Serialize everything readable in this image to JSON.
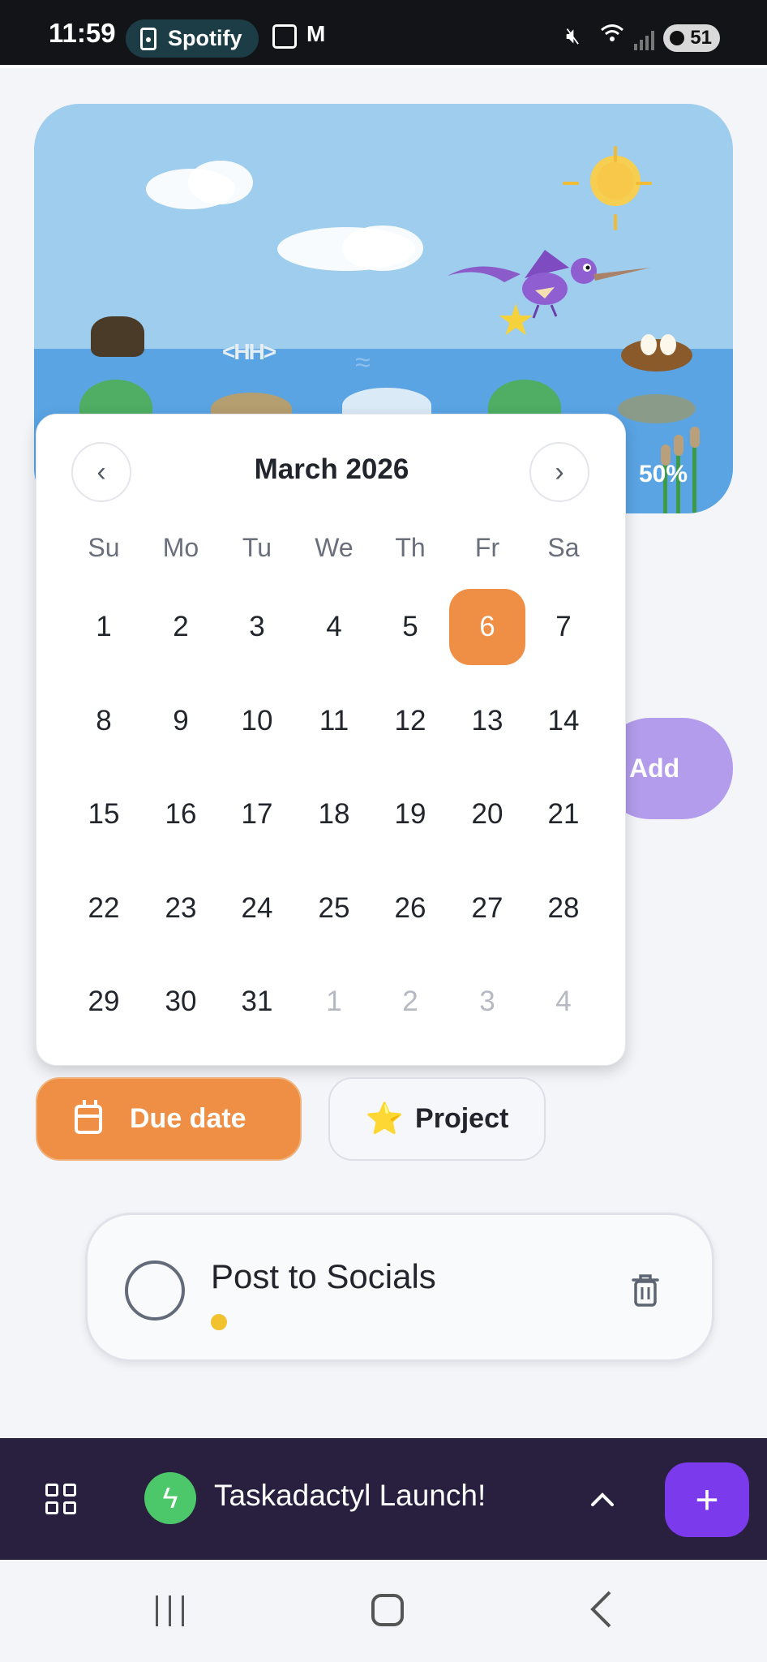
{
  "status_bar": {
    "time": "11:59",
    "media_app": "Spotify",
    "battery": "51",
    "icons": [
      "spotify-speaker-icon",
      "screenshot-icon",
      "gmail-icon",
      "mute-icon",
      "wifi-icon",
      "signal-icon",
      "battery-icon"
    ]
  },
  "scene": {
    "progress_label": "50%",
    "colors": {
      "sky": "#9ecdee",
      "water": "#5aa4e4"
    }
  },
  "add_button": {
    "label": "Add"
  },
  "calendar": {
    "month_title": "March 2026",
    "prev_icon": "chevron-left-icon",
    "next_icon": "chevron-right-icon",
    "weekdays": [
      "Su",
      "Mo",
      "Tu",
      "We",
      "Th",
      "Fr",
      "Sa"
    ],
    "days": [
      [
        "1",
        "2",
        "3",
        "4",
        "5",
        "6",
        "7"
      ],
      [
        "8",
        "9",
        "10",
        "11",
        "12",
        "13",
        "14"
      ],
      [
        "15",
        "16",
        "17",
        "18",
        "19",
        "20",
        "21"
      ],
      [
        "22",
        "23",
        "24",
        "25",
        "26",
        "27",
        "28"
      ],
      [
        "29",
        "30",
        "31",
        "1",
        "2",
        "3",
        "4"
      ]
    ],
    "selected_day": "6",
    "accent": "#ee8f45"
  },
  "chips": {
    "due_date_label": "Due date",
    "project_label": "Project",
    "project_emoji": "⭐"
  },
  "task": {
    "title": "Post to Socials",
    "dot_color": "#f2c12e"
  },
  "project_bar": {
    "name": "Taskadactyl Launch!",
    "fab_label": "+",
    "icons": [
      "grid-icon",
      "lightning-icon",
      "chevron-up-icon"
    ]
  },
  "nav_bar": {
    "icons": [
      "recents-icon",
      "home-icon",
      "back-icon"
    ]
  }
}
